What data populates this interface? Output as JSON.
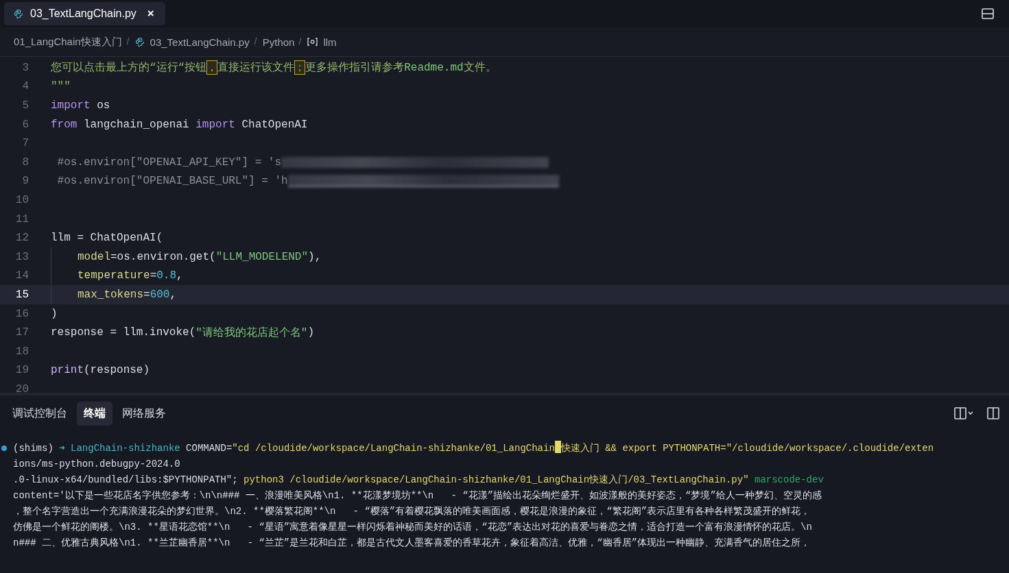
{
  "editor_tabs": [
    {
      "label": "03_TextLangChain.py",
      "selected": true,
      "close": "×"
    }
  ],
  "breadcrumbs": [
    {
      "label": "01_LangChain快速入门",
      "kind": "folder"
    },
    {
      "label": "03_TextLangChain.py",
      "kind": "file"
    },
    {
      "label": "Python",
      "kind": "language"
    },
    {
      "label": "llm",
      "kind": "symbol"
    }
  ],
  "code_lines": [
    {
      "number": "3",
      "current": false,
      "indented": false,
      "redacted": false,
      "tokens": [
        {
          "kind": "docstring",
          "text": "您可以点击最上方的“运行“按钮"
        },
        {
          "kind": "ambiguous",
          "text": "，"
        },
        {
          "kind": "docstring",
          "text": "直接运行该文件"
        },
        {
          "kind": "ambiguous",
          "text": "；"
        },
        {
          "kind": "docstring",
          "text": "更多操作指引请参考"
        },
        {
          "kind": "string",
          "text": "Readme.md"
        },
        {
          "kind": "docstring",
          "text": "文件。"
        }
      ]
    },
    {
      "number": "4",
      "current": false,
      "indented": false,
      "redacted": false,
      "tokens": [
        {
          "kind": "docstring",
          "text": "\"\"\""
        }
      ]
    },
    {
      "number": "5",
      "current": false,
      "indented": false,
      "redacted": false,
      "tokens": [
        {
          "kind": "keyword",
          "text": "import"
        },
        {
          "kind": "plain",
          "text": " os"
        }
      ]
    },
    {
      "number": "6",
      "current": false,
      "indented": false,
      "redacted": false,
      "tokens": [
        {
          "kind": "keyword",
          "text": "from"
        },
        {
          "kind": "plain",
          "text": " langchain_openai "
        },
        {
          "kind": "keyword",
          "text": "import"
        },
        {
          "kind": "plain",
          "text": " ChatOpenAI"
        }
      ]
    },
    {
      "number": "7",
      "current": false,
      "indented": false,
      "redacted": false
    },
    {
      "number": "8",
      "current": false,
      "indented": false,
      "redacted": true,
      "underlined": false,
      "tokens": [
        {
          "kind": "comment",
          "text": " #os.environ[\"OPENAI_API_KEY\"] = 's"
        }
      ]
    },
    {
      "number": "9",
      "current": false,
      "indented": false,
      "redacted": true,
      "underlined": true,
      "tokens": [
        {
          "kind": "comment",
          "text": " #os.environ[\"OPENAI_BASE_URL\"] = 'h"
        }
      ]
    },
    {
      "number": "10",
      "current": false,
      "indented": false,
      "redacted": false
    },
    {
      "number": "11",
      "current": false,
      "indented": false,
      "redacted": false
    },
    {
      "number": "12",
      "current": false,
      "indented": false,
      "redacted": false,
      "tokens": [
        {
          "kind": "plain",
          "text": "llm = ChatOpenAI("
        }
      ]
    },
    {
      "number": "13",
      "current": false,
      "indented": true,
      "redacted": false,
      "tokens": [
        {
          "kind": "param",
          "text": "model"
        },
        {
          "kind": "plain",
          "text": "=os.environ.get("
        },
        {
          "kind": "string",
          "text": "\"LLM_MODELEND\""
        },
        {
          "kind": "plain",
          "text": "),"
        }
      ]
    },
    {
      "number": "14",
      "current": false,
      "indented": true,
      "redacted": false,
      "tokens": [
        {
          "kind": "param",
          "text": "temperature"
        },
        {
          "kind": "plain",
          "text": "="
        },
        {
          "kind": "number",
          "text": "0.8"
        },
        {
          "kind": "plain",
          "text": ","
        }
      ]
    },
    {
      "number": "15",
      "current": true,
      "indented": true,
      "redacted": false,
      "tokens": [
        {
          "kind": "param",
          "text": "max_tokens"
        },
        {
          "kind": "plain",
          "text": "="
        },
        {
          "kind": "number",
          "text": "600"
        },
        {
          "kind": "plain",
          "text": ","
        }
      ]
    },
    {
      "number": "16",
      "current": false,
      "indented": false,
      "redacted": false,
      "tokens": [
        {
          "kind": "plain",
          "text": ")"
        }
      ]
    },
    {
      "number": "17",
      "current": false,
      "indented": false,
      "redacted": false,
      "tokens": [
        {
          "kind": "plain",
          "text": "response = llm.invoke("
        },
        {
          "kind": "string",
          "text": "\"请给我的花店起个名\""
        },
        {
          "kind": "plain",
          "text": ")"
        }
      ]
    },
    {
      "number": "18",
      "current": false,
      "indented": false,
      "redacted": false
    },
    {
      "number": "19",
      "current": false,
      "indented": false,
      "redacted": false,
      "tokens": [
        {
          "kind": "builtin",
          "text": "print"
        },
        {
          "kind": "plain",
          "text": "(response)"
        }
      ]
    },
    {
      "number": "20",
      "current": false,
      "indented": false,
      "redacted": false
    }
  ],
  "panel_tabs": [
    {
      "label": "调试控制台",
      "selected": false
    },
    {
      "label": "终端",
      "selected": true
    },
    {
      "label": "网络服务",
      "selected": false
    }
  ],
  "terminal_lines": [
    {
      "marker": true,
      "tokens": [
        {
          "kind": "plain",
          "text": "(shims) "
        },
        {
          "kind": "prompt",
          "text": "➜"
        },
        {
          "kind": "prompt",
          "text": " LangChain-shizhanke"
        },
        {
          "kind": "plain",
          "text": " COMMAND="
        },
        {
          "kind": "quoted",
          "text": "\"cd /cloudide/workspace/LangChain-shizhanke/01_LangChain"
        },
        {
          "kind": "cursor"
        },
        {
          "kind": "quoted",
          "text": "快速入门 && export PYTHONPATH=\"/cloudide/workspace/.cloudide/exten"
        }
      ]
    },
    {
      "marker": false,
      "tokens": [
        {
          "kind": "plain",
          "text": "ions/ms-python.debugpy-2024.0"
        }
      ]
    },
    {
      "marker": false,
      "tokens": [
        {
          "kind": "plain",
          "text": ".0-linux-x64/bundled/libs:$PYTHONPATH\"; "
        },
        {
          "kind": "quoted",
          "text": "python3 /cloudide/workspace/LangChain-shizhanke/01_LangChain快速入门/03_TextLangChain.py\""
        },
        {
          "kind": "branch",
          "text": " marscode-dev"
        }
      ]
    },
    {
      "marker": false,
      "tokens": [
        {
          "kind": "plain",
          "text": "content='以下是一些花店名字供您参考：\\n\\n### 一、浪漫唯美风格\\n1. **花漾梦境坊**\\n   - “花漾”描绘出花朵绚烂盛开、如波漾般的美好姿态，“梦境”给人一种梦幻、空灵的感"
        }
      ]
    },
    {
      "marker": false,
      "tokens": [
        {
          "kind": "plain",
          "text": "，整个名字营造出一个充满浪漫花朵的梦幻世界。\\n2. **樱落繁花阁**\\n   - “樱落”有着樱花飘落的唯美画面感，樱花是浪漫的象征，“繁花阁”表示店里有各种各样繁茂盛开的鲜花，"
        }
      ]
    },
    {
      "marker": false,
      "tokens": [
        {
          "kind": "plain",
          "text": "仿佛是一个鲜花的阁楼。\\n3. **星语花恋馆**\\n   - “星语”寓意着像星星一样闪烁着神秘而美好的话语，“花恋”表达出对花的喜爱与眷恋之情，适合打造一个富有浪漫情怀的花店。\\n"
        }
      ]
    },
    {
      "marker": false,
      "tokens": [
        {
          "kind": "plain",
          "text": "n### 二、优雅古典风格\\n1. **兰芷幽香居**\\n   - “兰芷”是兰花和白芷，都是古代文人墨客喜爱的香草花卉，象征着高洁、优雅，“幽香居”体现出一种幽静、充满香气的居住之所，"
        }
      ]
    }
  ]
}
